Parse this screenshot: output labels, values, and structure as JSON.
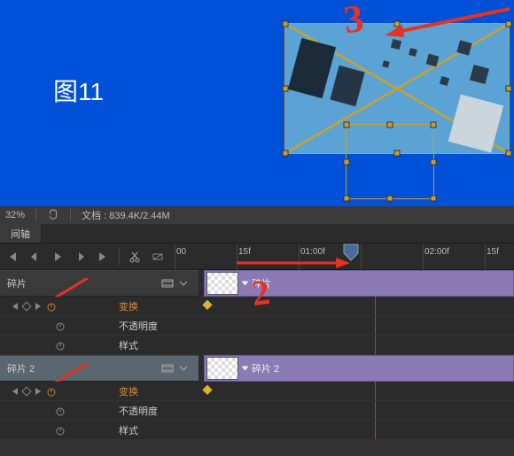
{
  "canvas": {
    "label": "图11"
  },
  "status": {
    "zoom": "32%",
    "doc_label": "文档",
    "doc_size": "839.4K/2.44M"
  },
  "tab": {
    "timeline": "间轴"
  },
  "ruler": {
    "ticks": [
      {
        "pos": 0,
        "label": "00"
      },
      {
        "pos": 70,
        "label": "15f"
      },
      {
        "pos": 140,
        "label": "01:00f"
      },
      {
        "pos": 280,
        "label": "02:00f"
      },
      {
        "pos": 350,
        "label": "15f"
      }
    ]
  },
  "layers": [
    {
      "name": "碎片",
      "clip_label": "碎片",
      "props": [
        {
          "label": "变换",
          "hl": true,
          "keys": true
        },
        {
          "label": "不透明度",
          "hl": false,
          "keys": false
        },
        {
          "label": "样式",
          "hl": false,
          "keys": false
        }
      ]
    },
    {
      "name": "碎片 2",
      "clip_label": "碎片 2",
      "props": [
        {
          "label": "变换",
          "hl": true,
          "keys": true
        },
        {
          "label": "不透明度",
          "hl": false,
          "keys": false
        },
        {
          "label": "样式",
          "hl": false,
          "keys": false
        }
      ]
    }
  ],
  "annotations": {
    "num_top": "3",
    "num_mid": "2"
  }
}
